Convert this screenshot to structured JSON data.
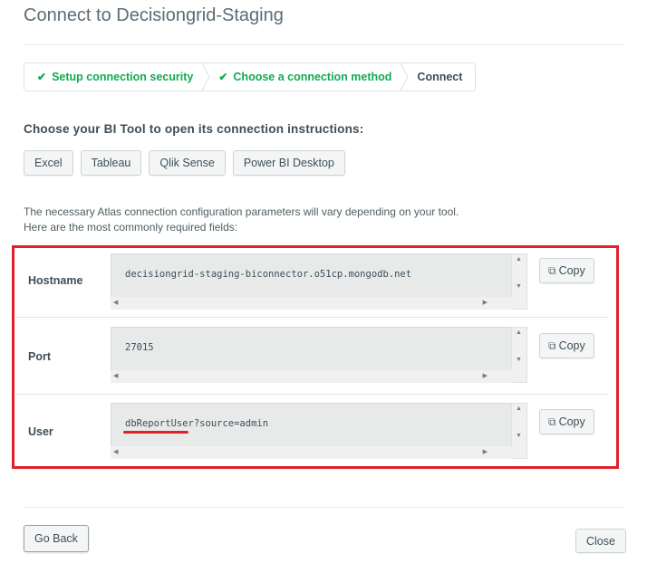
{
  "modal": {
    "title": "Connect to Decisiongrid-Staging"
  },
  "steps": [
    {
      "label": "Setup connection security",
      "state": "done"
    },
    {
      "label": "Choose a connection method",
      "state": "done"
    },
    {
      "label": "Connect",
      "state": "current"
    }
  ],
  "bi_tools": {
    "heading": "Choose your BI Tool to open its connection instructions:",
    "options": [
      "Excel",
      "Tableau",
      "Qlik Sense",
      "Power BI Desktop"
    ]
  },
  "info": {
    "line1": "The necessary Atlas connection configuration parameters will vary depending on your tool.",
    "line2": "Here are the most commonly required fields:"
  },
  "fields": [
    {
      "label": "Hostname",
      "value": "decisiongrid-staging-biconnector.o51cp.mongodb.net",
      "copy_label": "Copy"
    },
    {
      "label": "Port",
      "value": "27015",
      "copy_label": "Copy"
    },
    {
      "label": "User",
      "value": "dbReportUser?source=admin",
      "copy_label": "Copy"
    }
  ],
  "footer": {
    "back_label": "Go Back",
    "close_label": "Close"
  },
  "colors": {
    "success": "#13aa52",
    "highlight": "#e0212a"
  }
}
